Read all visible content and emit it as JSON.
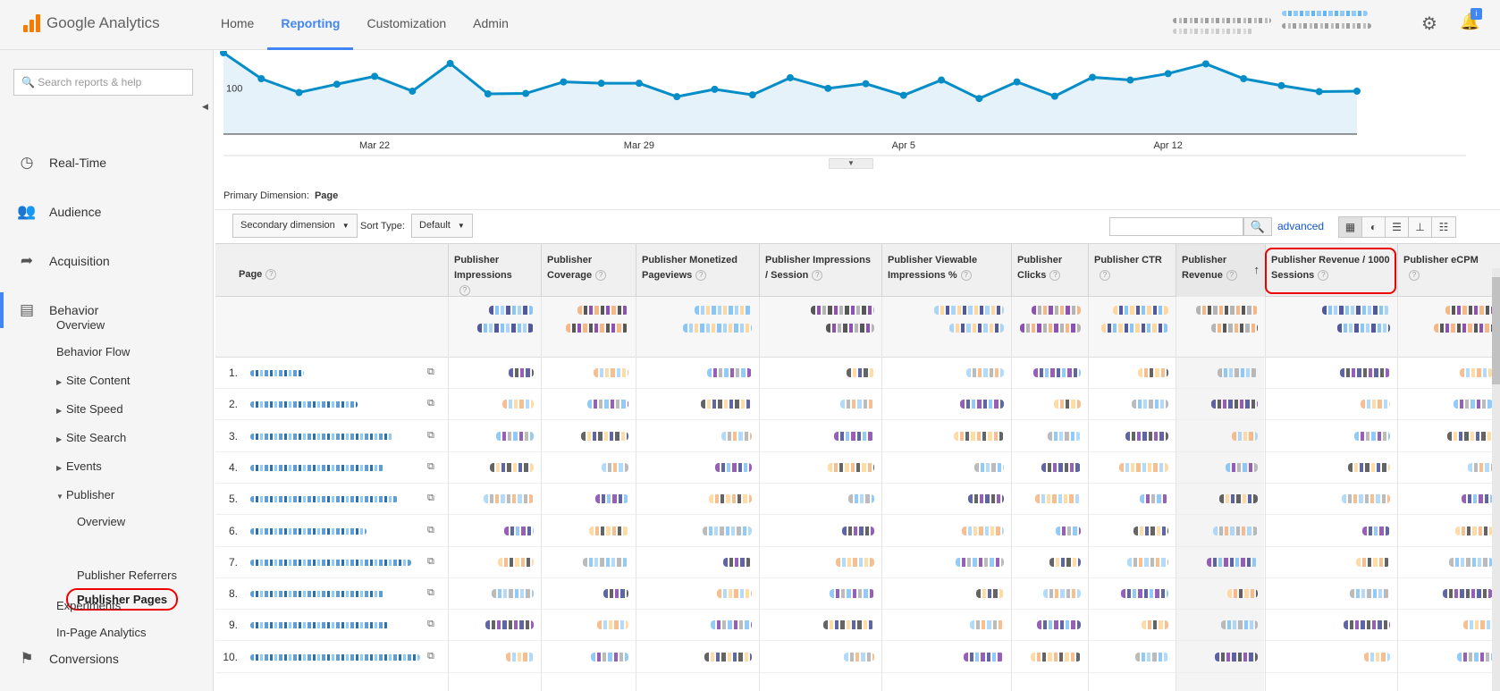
{
  "app": {
    "logo_text": "Google Analytics",
    "brand_color": "#f57c00",
    "accent_color": "#4285f4"
  },
  "topnav": {
    "tabs": [
      {
        "label": "Home",
        "active": false
      },
      {
        "label": "Reporting",
        "active": true
      },
      {
        "label": "Customization",
        "active": false
      },
      {
        "label": "Admin",
        "active": false
      }
    ]
  },
  "header_icons": {
    "settings": "gear-icon",
    "notifications": "bell-icon",
    "notification_badge": "i"
  },
  "sidebar": {
    "search_placeholder": "Search reports & help",
    "sections": [
      {
        "label": "Real-Time",
        "icon": "clock-icon"
      },
      {
        "label": "Audience",
        "icon": "people-icon"
      },
      {
        "label": "Acquisition",
        "icon": "acquisition-icon"
      },
      {
        "label": "Behavior",
        "icon": "behavior-icon",
        "active": true
      },
      {
        "label": "Conversions",
        "icon": "flag-icon"
      }
    ],
    "behavior_items": [
      {
        "label": "Overview"
      },
      {
        "label": "Behavior Flow"
      },
      {
        "label": "Site Content",
        "expandable": true
      },
      {
        "label": "Site Speed",
        "expandable": true
      },
      {
        "label": "Site Search",
        "expandable": true
      },
      {
        "label": "Events",
        "expandable": true
      },
      {
        "label": "Publisher",
        "expanded": true
      },
      {
        "label": "Overview"
      },
      {
        "label": "Publisher Pages",
        "selected": true
      },
      {
        "label": "Publisher Referrers"
      },
      {
        "label": "Experiments"
      },
      {
        "label": "In-Page Analytics"
      }
    ]
  },
  "chart_data": {
    "type": "area",
    "x_ticks": [
      "Mar 22",
      "Mar 29",
      "Apr 5",
      "Apr 12"
    ],
    "y_ticks": [
      "100"
    ],
    "ylim": [
      0,
      180
    ],
    "values": [
      176,
      120,
      90,
      108,
      125,
      93,
      153,
      87,
      88,
      113,
      110,
      110,
      81,
      97,
      85,
      122,
      99,
      109,
      84,
      117,
      77,
      113,
      82,
      123,
      117,
      131,
      152,
      120,
      105,
      92,
      93
    ],
    "line_color": "#058dc7",
    "fill_color": "#e6f2fa",
    "grid": false
  },
  "primary_dimension": {
    "label": "Primary Dimension:",
    "value": "Page"
  },
  "toolbar": {
    "secondary_dimension": "Secondary dimension",
    "sort_type_label": "Sort Type:",
    "sort_type_value": "Default",
    "advanced_link": "advanced",
    "view_icons": [
      "table-view-icon",
      "pie-view-icon",
      "bar-view-icon",
      "comparison-view-icon",
      "pivot-view-icon"
    ]
  },
  "table": {
    "page_header": "Page",
    "columns": [
      "Publisher Impressions",
      "Publisher Coverage",
      "Publisher Monetized Pageviews",
      "Publisher Impressions / Session",
      "Publisher Viewable Impressions %",
      "Publisher Clicks",
      "Publisher CTR",
      "Publisher Revenue",
      "Publisher Revenue / 1000 Sessions",
      "Publisher eCPM"
    ],
    "sorted_column": "Publisher Revenue",
    "highlighted_column": "Publisher Revenue / 1000 Sessions",
    "rows": [
      {
        "num": "1."
      },
      {
        "num": "2."
      },
      {
        "num": "3."
      },
      {
        "num": "4."
      },
      {
        "num": "5."
      },
      {
        "num": "6."
      },
      {
        "num": "7."
      },
      {
        "num": "8."
      },
      {
        "num": "9."
      },
      {
        "num": "10."
      }
    ]
  }
}
